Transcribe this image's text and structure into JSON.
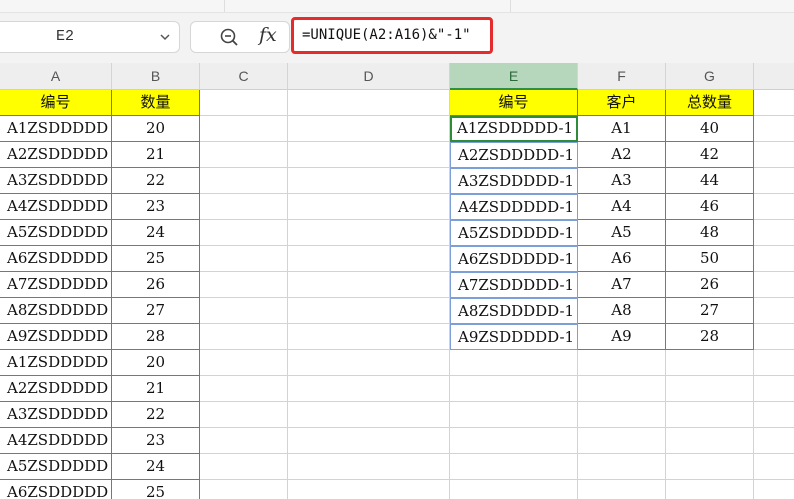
{
  "name_box": {
    "value": "E2"
  },
  "formula_bar": {
    "formula": "=UNIQUE(A2:A16)&\"-1\""
  },
  "icons": {
    "zoom": "zoom-icon",
    "function": "fx-icon",
    "dropdown": "chevron-down-icon"
  },
  "colors": {
    "header_fill": "#ffff00",
    "highlight_border": "#e52b2b",
    "selected_cell": "#2e8b3a"
  },
  "columns": [
    "A",
    "B",
    "C",
    "D",
    "E",
    "F",
    "G"
  ],
  "selected_column": "E",
  "left_table": {
    "headers": [
      "编号",
      "数量"
    ],
    "rows": [
      [
        "A1ZSDDDDD",
        "20"
      ],
      [
        "A2ZSDDDDD",
        "21"
      ],
      [
        "A3ZSDDDDD",
        "22"
      ],
      [
        "A4ZSDDDDD",
        "23"
      ],
      [
        "A5ZSDDDDD",
        "24"
      ],
      [
        "A6ZSDDDDD",
        "25"
      ],
      [
        "A7ZSDDDDD",
        "26"
      ],
      [
        "A8ZSDDDDD",
        "27"
      ],
      [
        "A9ZSDDDDD",
        "28"
      ],
      [
        "A1ZSDDDDD",
        "20"
      ],
      [
        "A2ZSDDDDD",
        "21"
      ],
      [
        "A3ZSDDDDD",
        "22"
      ],
      [
        "A4ZSDDDDD",
        "23"
      ],
      [
        "A5ZSDDDDD",
        "24"
      ],
      [
        "A6ZSDDDDD",
        "25"
      ]
    ]
  },
  "right_table": {
    "headers": [
      "编号",
      "客户",
      "总数量"
    ],
    "rows": [
      [
        "A1ZSDDDDD-1",
        "A1",
        "40"
      ],
      [
        "A2ZSDDDDD-1",
        "A2",
        "42"
      ],
      [
        "A3ZSDDDDD-1",
        "A3",
        "44"
      ],
      [
        "A4ZSDDDDD-1",
        "A4",
        "46"
      ],
      [
        "A5ZSDDDDD-1",
        "A5",
        "48"
      ],
      [
        "A6ZSDDDDD-1",
        "A6",
        "50"
      ],
      [
        "A7ZSDDDDD-1",
        "A7",
        "26"
      ],
      [
        "A8ZSDDDDD-1",
        "A8",
        "27"
      ],
      [
        "A9ZSDDDDD-1",
        "A9",
        "28"
      ]
    ]
  }
}
